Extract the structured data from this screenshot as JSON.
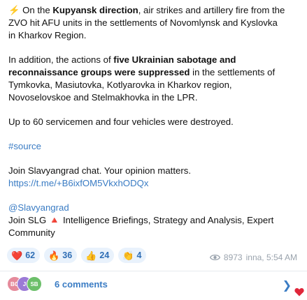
{
  "post": {
    "p1": {
      "bolt": "⚡️",
      "pre": " On the ",
      "bold": "Kupyansk direction",
      "post": ", air strikes and artillery fire from the",
      "line2": "ZVO hit AFU units in the settlements of Novomlynsk and Kyslovka",
      "line3": "in Kharkov Region."
    },
    "p2": {
      "pre": "In addition, the actions of ",
      "bold1": "five Ukrainian sabotage and",
      "bold2": "reconnaissance groups were suppressed",
      "post": " in the settlements of",
      "line3": "Tymkovka, Masiutovka, Kotlyarovka in Kharkov region,",
      "line4": "Novoselovskoe and Stelmakhovka in the LPR."
    },
    "p3": "Up to 60 servicemen and four vehicles were destroyed.",
    "hashtag": "#source",
    "chat": {
      "text": "Join Slavyangrad chat. Your opinion matters.",
      "link": "https://t.me/+B6ixfOM5VkxhODQx"
    },
    "footer": {
      "handle": "@Slavyangrad",
      "join_pre": "Join SLG ",
      "triangle": "🔺",
      "join_post": " Intelligence Briefings, Strategy and Analysis, Expert",
      "line2": "Community"
    }
  },
  "reactions": [
    {
      "emoji": "❤️",
      "count": "62",
      "name": "heart"
    },
    {
      "emoji": "🔥",
      "count": "36",
      "name": "fire"
    },
    {
      "emoji": "👍",
      "count": "24",
      "name": "thumbs-up"
    },
    {
      "emoji": "👏",
      "count": "4",
      "name": "clap"
    }
  ],
  "meta": {
    "views": "8973",
    "author_time": "inna, 5:54 AM"
  },
  "comments": {
    "label": "6 comments",
    "avatars": [
      {
        "initials": "BO",
        "color": "#e58a9b"
      },
      {
        "initials": "J",
        "color": "#9b7ad6"
      },
      {
        "initials": "SB",
        "color": "#6cbf6a"
      }
    ]
  },
  "colors": {
    "link": "#3a7cc4",
    "chip_bg": "#e9f2fc",
    "meta_text": "#9aa3ad"
  }
}
